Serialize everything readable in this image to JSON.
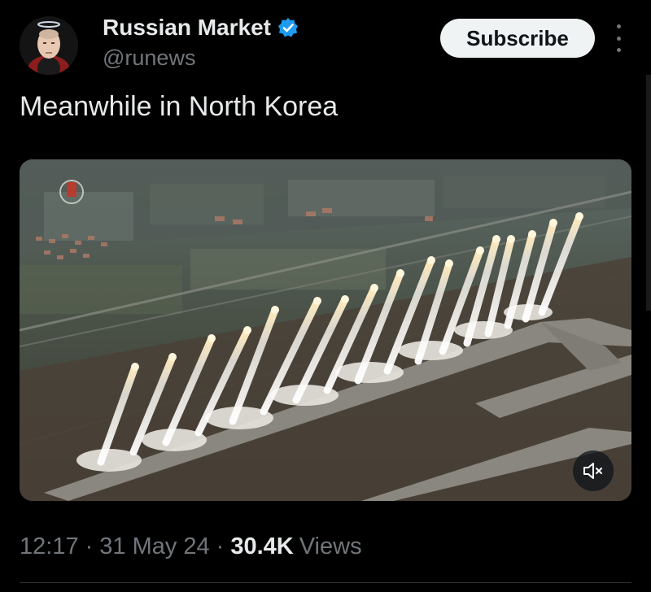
{
  "author": {
    "name": "Russian Market",
    "handle": "@runews",
    "verified": true
  },
  "subscribe_label": "Subscribe",
  "more_icon": "more-vertical-icon",
  "post": {
    "text": "Meanwhile in North Korea"
  },
  "media": {
    "type": "video",
    "muted": true,
    "mute_icon": "speaker-muted-icon"
  },
  "meta": {
    "time": "12:17",
    "separator": "·",
    "date": "31 May 24",
    "views_count": "30.4K",
    "views_label": "Views"
  },
  "colors": {
    "background": "#000000",
    "text_primary": "#e7e9ea",
    "text_secondary": "#71767b",
    "verified_blue": "#1d9bf0",
    "button_bg": "#eff3f4",
    "button_text": "#0f1419",
    "divider": "#2f3336"
  }
}
